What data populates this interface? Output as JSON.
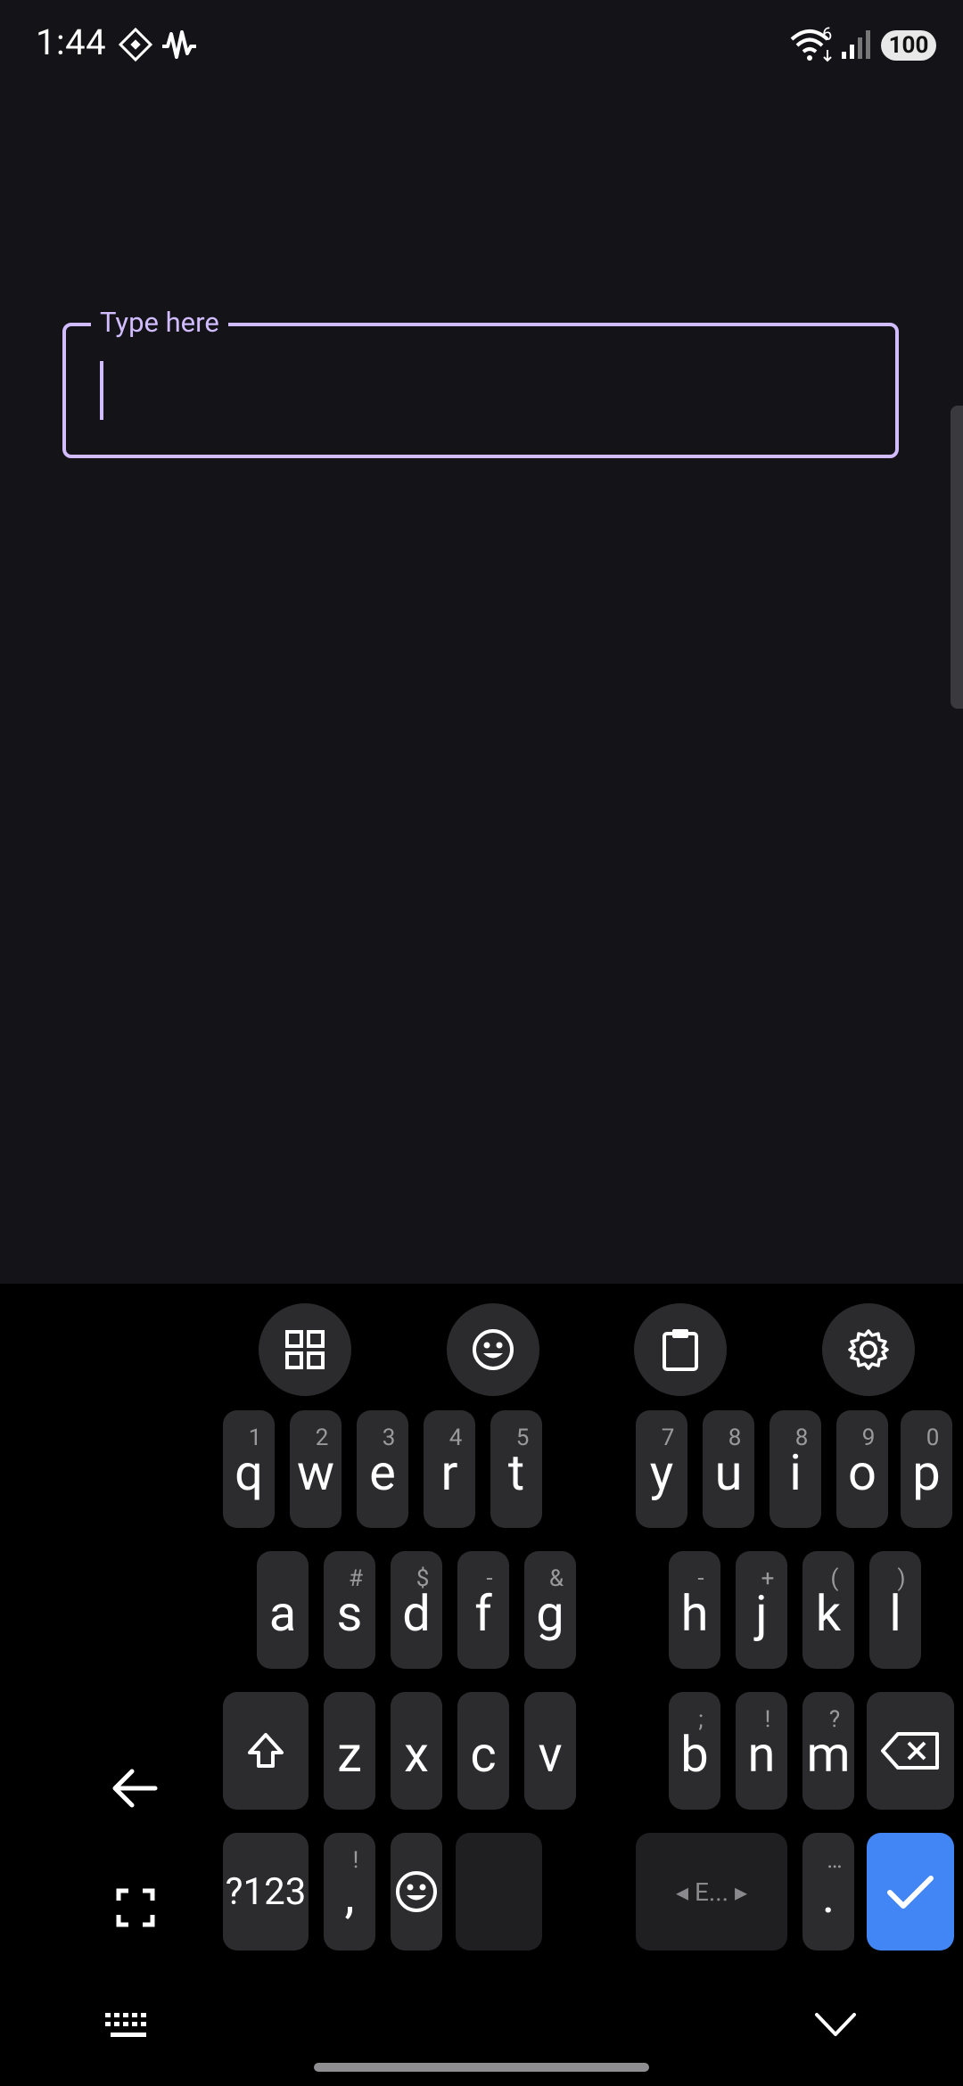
{
  "status_bar": {
    "time": "1:44",
    "battery": "100",
    "network_badge": "6"
  },
  "text_field": {
    "label": "Type here",
    "value": ""
  },
  "keyboard": {
    "row1": [
      {
        "key": "q",
        "hint": "1"
      },
      {
        "key": "w",
        "hint": "2"
      },
      {
        "key": "e",
        "hint": "3"
      },
      {
        "key": "r",
        "hint": "4"
      },
      {
        "key": "t",
        "hint": "5"
      },
      {
        "key": "y",
        "hint": "7"
      },
      {
        "key": "u",
        "hint": "8"
      },
      {
        "key": "i",
        "hint": "8"
      },
      {
        "key": "o",
        "hint": "9"
      },
      {
        "key": "p",
        "hint": "0"
      }
    ],
    "row2": [
      {
        "key": "a",
        "hint": ""
      },
      {
        "key": "s",
        "hint": "#"
      },
      {
        "key": "d",
        "hint": "$"
      },
      {
        "key": "f",
        "hint": "-"
      },
      {
        "key": "g",
        "hint": "&"
      },
      {
        "key": "h",
        "hint": "-"
      },
      {
        "key": "j",
        "hint": "+"
      },
      {
        "key": "k",
        "hint": "("
      },
      {
        "key": "l",
        "hint": ")"
      }
    ],
    "row3": [
      {
        "key": "z",
        "hint": ""
      },
      {
        "key": "x",
        "hint": ""
      },
      {
        "key": "c",
        "hint": ""
      },
      {
        "key": "v",
        "hint": ""
      },
      {
        "key": "b",
        "hint": ";"
      },
      {
        "key": "n",
        "hint": "!"
      },
      {
        "key": "m",
        "hint": "?"
      }
    ],
    "symbols_label": "?123",
    "comma_label": ",",
    "comma_hint": "!",
    "period_label": ".",
    "period_hint": "…",
    "space_label": "◂ E... ▸"
  }
}
